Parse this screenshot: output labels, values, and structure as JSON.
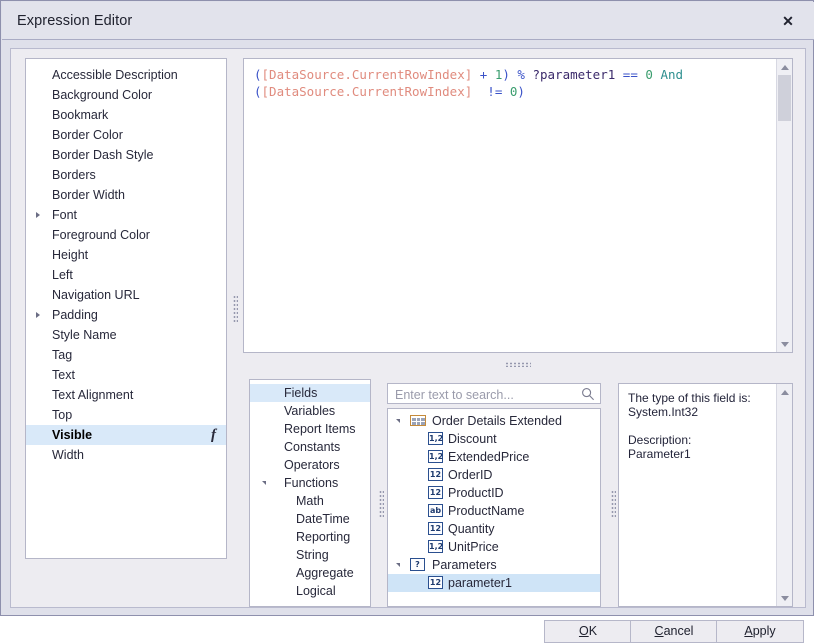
{
  "window": {
    "title": "Expression Editor",
    "close_label": "✕"
  },
  "properties": {
    "items": [
      {
        "label": "Accessible Description",
        "expandable": false,
        "selected": false,
        "fx": false
      },
      {
        "label": "Background Color",
        "expandable": false,
        "selected": false,
        "fx": false
      },
      {
        "label": "Bookmark",
        "expandable": false,
        "selected": false,
        "fx": false
      },
      {
        "label": "Border Color",
        "expandable": false,
        "selected": false,
        "fx": false
      },
      {
        "label": "Border Dash Style",
        "expandable": false,
        "selected": false,
        "fx": false
      },
      {
        "label": "Borders",
        "expandable": false,
        "selected": false,
        "fx": false
      },
      {
        "label": "Border Width",
        "expandable": false,
        "selected": false,
        "fx": false
      },
      {
        "label": "Font",
        "expandable": true,
        "selected": false,
        "fx": false
      },
      {
        "label": "Foreground Color",
        "expandable": false,
        "selected": false,
        "fx": false
      },
      {
        "label": "Height",
        "expandable": false,
        "selected": false,
        "fx": false
      },
      {
        "label": "Left",
        "expandable": false,
        "selected": false,
        "fx": false
      },
      {
        "label": "Navigation URL",
        "expandable": false,
        "selected": false,
        "fx": false
      },
      {
        "label": "Padding",
        "expandable": true,
        "selected": false,
        "fx": false
      },
      {
        "label": "Style Name",
        "expandable": false,
        "selected": false,
        "fx": false
      },
      {
        "label": "Tag",
        "expandable": false,
        "selected": false,
        "fx": false
      },
      {
        "label": "Text",
        "expandable": false,
        "selected": false,
        "fx": false
      },
      {
        "label": "Text Alignment",
        "expandable": false,
        "selected": false,
        "fx": false
      },
      {
        "label": "Top",
        "expandable": false,
        "selected": false,
        "fx": false
      },
      {
        "label": "Visible",
        "expandable": false,
        "selected": true,
        "fx": true,
        "fx_glyph": "f"
      },
      {
        "label": "Width",
        "expandable": false,
        "selected": false,
        "fx": false
      }
    ]
  },
  "editor": {
    "lines": [
      [
        {
          "t": "(",
          "k": "paren"
        },
        {
          "t": "[DataSource.CurrentRowIndex]",
          "k": "field"
        },
        {
          "t": " + ",
          "k": "op"
        },
        {
          "t": "1",
          "k": "num"
        },
        {
          "t": ")",
          "k": "paren"
        },
        {
          "t": " % ",
          "k": "op"
        },
        {
          "t": "?parameter1",
          "k": "param"
        },
        {
          "t": " == ",
          "k": "op"
        },
        {
          "t": "0",
          "k": "num"
        },
        {
          "t": " ",
          "k": "plain"
        },
        {
          "t": "And",
          "k": "kw"
        }
      ],
      [
        {
          "t": "(",
          "k": "paren"
        },
        {
          "t": "[DataSource.CurrentRowIndex]",
          "k": "field"
        },
        {
          "t": "  != ",
          "k": "op"
        },
        {
          "t": "0",
          "k": "num"
        },
        {
          "t": ")",
          "k": "paren"
        }
      ]
    ],
    "plain_text": "([DataSource.CurrentRowIndex] + 1) % ?parameter1 == 0 And\n([DataSource.CurrentRowIndex]  != 0)"
  },
  "categories": {
    "items": [
      {
        "label": "Fields",
        "indent": 0,
        "selected": true,
        "expanded": false
      },
      {
        "label": "Variables",
        "indent": 0,
        "selected": false,
        "expanded": false
      },
      {
        "label": "Report Items",
        "indent": 0,
        "selected": false,
        "expanded": false
      },
      {
        "label": "Constants",
        "indent": 0,
        "selected": false,
        "expanded": false
      },
      {
        "label": "Operators",
        "indent": 0,
        "selected": false,
        "expanded": false
      },
      {
        "label": "Functions",
        "indent": 0,
        "selected": false,
        "expanded": true
      },
      {
        "label": "Math",
        "indent": 1,
        "selected": false,
        "expanded": false
      },
      {
        "label": "DateTime",
        "indent": 1,
        "selected": false,
        "expanded": false
      },
      {
        "label": "Reporting",
        "indent": 1,
        "selected": false,
        "expanded": false
      },
      {
        "label": "String",
        "indent": 1,
        "selected": false,
        "expanded": false
      },
      {
        "label": "Aggregate",
        "indent": 1,
        "selected": false,
        "expanded": false
      },
      {
        "label": "Logical",
        "indent": 1,
        "selected": false,
        "expanded": false
      }
    ]
  },
  "search": {
    "placeholder": "Enter text to search...",
    "value": "",
    "icon": "search-icon"
  },
  "tree": {
    "items": [
      {
        "label": "Order Details Extended",
        "level": 0,
        "icon": "table",
        "icon_text": "",
        "expanded": true,
        "selected": false
      },
      {
        "label": "Discount",
        "level": 1,
        "icon": "badge",
        "icon_text": "1,2",
        "expanded": false,
        "selected": false
      },
      {
        "label": "ExtendedPrice",
        "level": 1,
        "icon": "badge",
        "icon_text": "1,2",
        "expanded": false,
        "selected": false
      },
      {
        "label": "OrderID",
        "level": 1,
        "icon": "badge",
        "icon_text": "12",
        "expanded": false,
        "selected": false
      },
      {
        "label": "ProductID",
        "level": 1,
        "icon": "badge",
        "icon_text": "12",
        "expanded": false,
        "selected": false
      },
      {
        "label": "ProductName",
        "level": 1,
        "icon": "badge",
        "icon_text": "ab",
        "expanded": false,
        "selected": false
      },
      {
        "label": "Quantity",
        "level": 1,
        "icon": "badge",
        "icon_text": "12",
        "expanded": false,
        "selected": false
      },
      {
        "label": "UnitPrice",
        "level": 1,
        "icon": "badge",
        "icon_text": "1,2",
        "expanded": false,
        "selected": false
      },
      {
        "label": "Parameters",
        "level": 0,
        "icon": "badge",
        "icon_text": "?",
        "expanded": true,
        "selected": false
      },
      {
        "label": "parameter1",
        "level": 1,
        "icon": "badge",
        "icon_text": "12",
        "expanded": false,
        "selected": true
      }
    ]
  },
  "description": {
    "text": "The type of this field is:\nSystem.Int32\n\nDescription:\nParameter1"
  },
  "buttons": {
    "ok": {
      "pre": "",
      "mn": "O",
      "post": "K"
    },
    "cancel": {
      "pre": "",
      "mn": "C",
      "post": "ancel"
    },
    "apply": {
      "pre": "",
      "mn": "A",
      "post": "pply"
    }
  },
  "colors": {
    "selection": "#d9e9f9",
    "tree_selection": "#cfe4f7",
    "titlebar": "#e2e3ec",
    "dialog_bg": "#edecf1",
    "window_border": "#8e90ad",
    "syntax_paren": "#3a52c8",
    "syntax_field": "#e08b7e",
    "syntax_number": "#3a9d6e",
    "syntax_param": "#3b2a6b",
    "syntax_keyword": "#2e8f8f"
  }
}
